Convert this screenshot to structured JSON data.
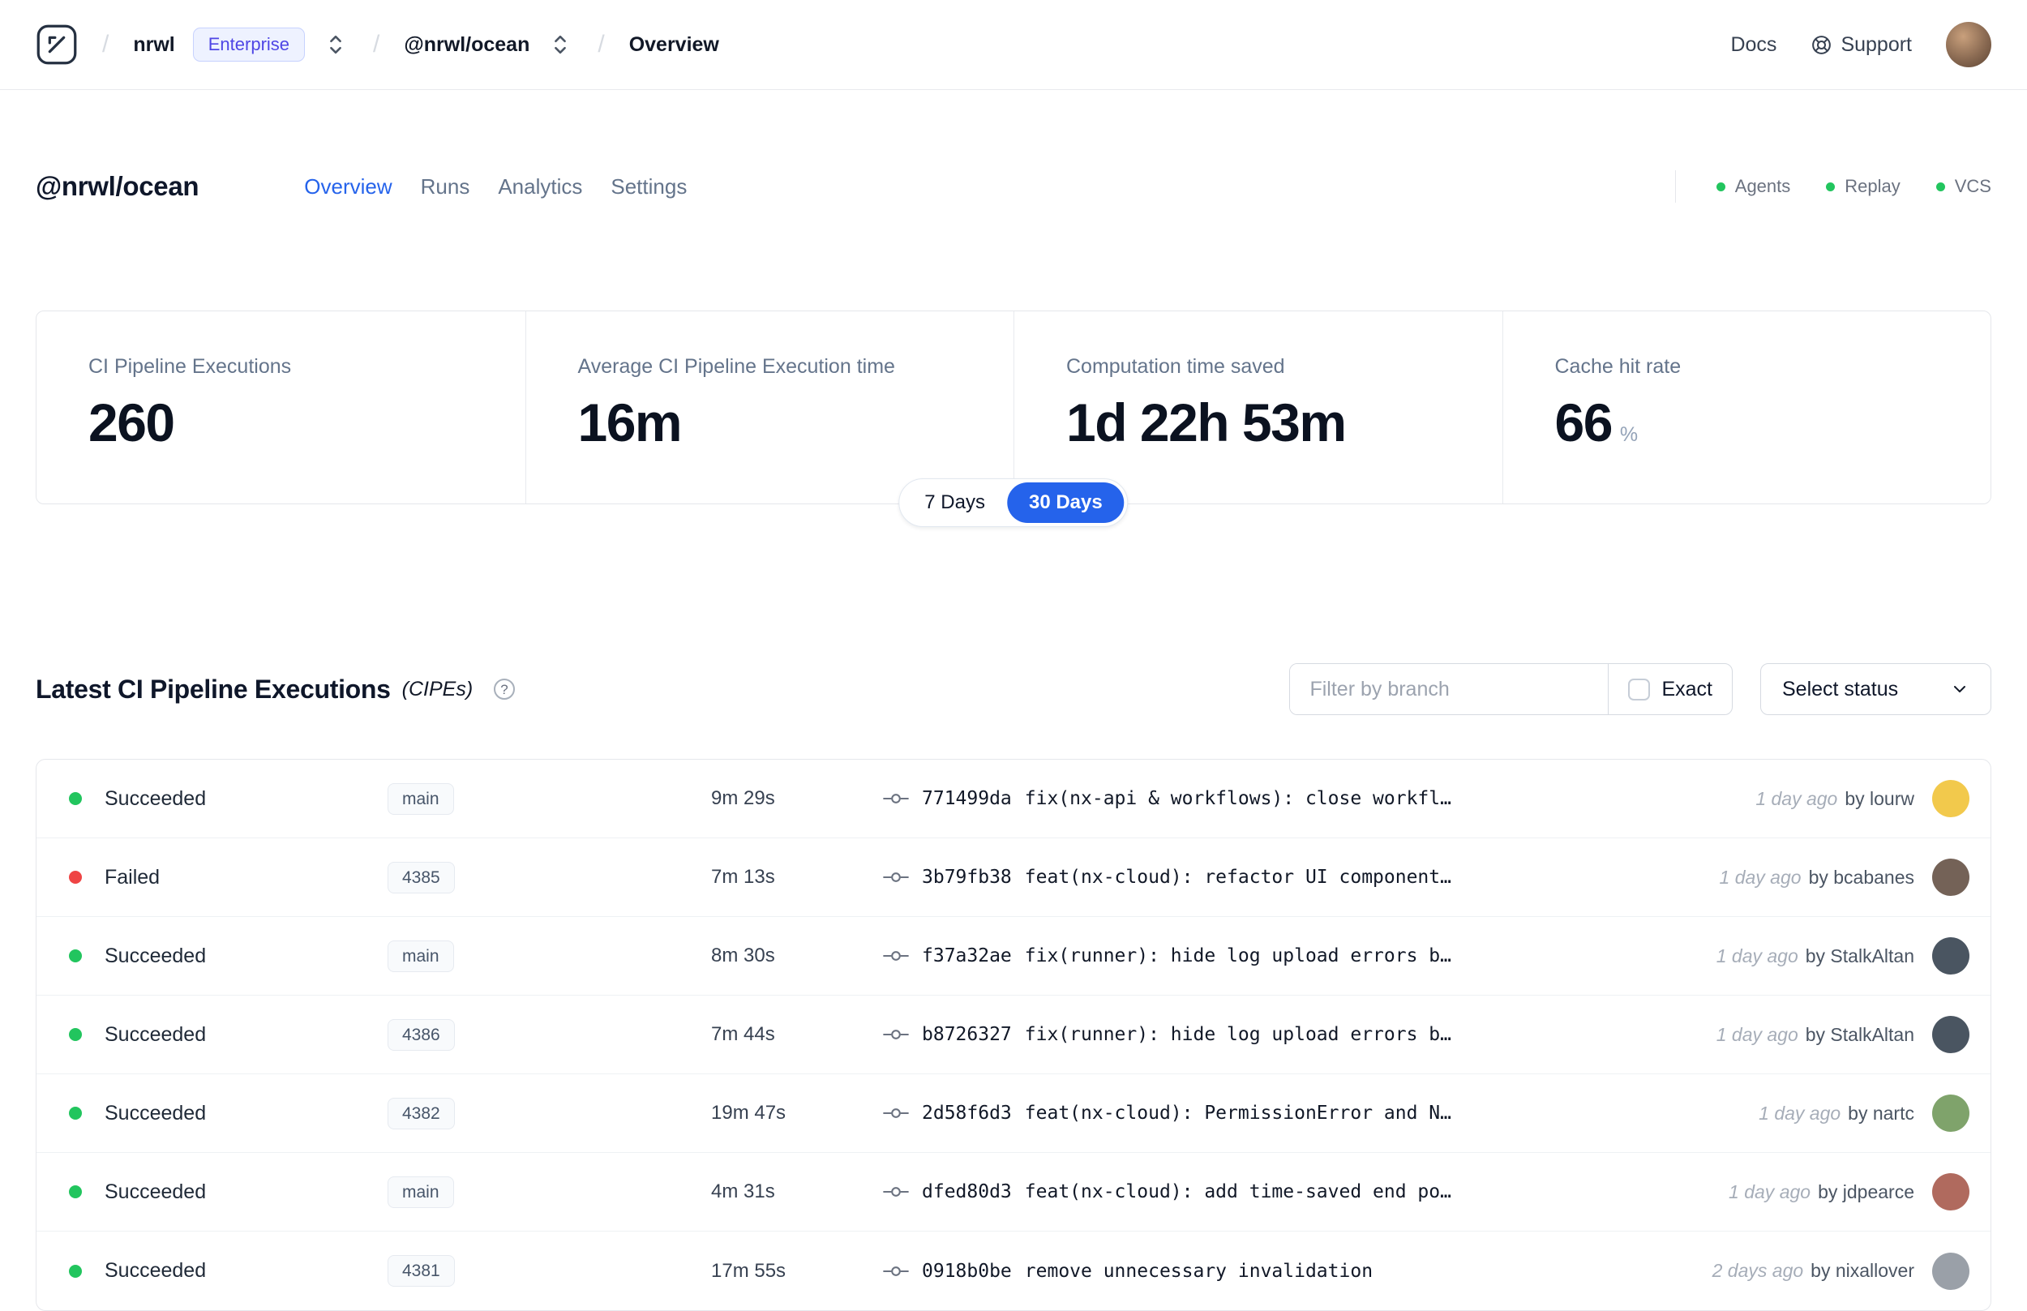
{
  "nav": {
    "breadcrumb": {
      "separator": "/",
      "org": "nrwl",
      "plan_badge": "Enterprise",
      "workspace": "@nrwl/ocean",
      "page": "Overview"
    },
    "docs_label": "Docs",
    "support_label": "Support"
  },
  "workspace": {
    "title": "@nrwl/ocean",
    "tabs": [
      {
        "label": "Overview",
        "active": true
      },
      {
        "label": "Runs",
        "active": false
      },
      {
        "label": "Analytics",
        "active": false
      },
      {
        "label": "Settings",
        "active": false
      }
    ],
    "indicators": [
      {
        "label": "Agents"
      },
      {
        "label": "Replay"
      },
      {
        "label": "VCS"
      }
    ]
  },
  "stats": [
    {
      "label": "CI Pipeline Executions",
      "value": "260"
    },
    {
      "label": "Average CI Pipeline Execution time",
      "value": "16m"
    },
    {
      "label": "Computation time saved",
      "value": "1d 22h 53m"
    },
    {
      "label": "Cache hit rate",
      "value": "66",
      "suffix": "%"
    }
  ],
  "range_toggle": {
    "options": [
      {
        "label": "7 Days",
        "active": false
      },
      {
        "label": "30 Days",
        "active": true
      }
    ]
  },
  "cipes": {
    "title": "Latest CI Pipeline Executions",
    "subtitle": "(CIPEs)",
    "filter": {
      "placeholder": "Filter by branch",
      "exact_label": "Exact"
    },
    "status_select_label": "Select status",
    "rows": [
      {
        "status": "Succeeded",
        "status_color": "green",
        "branch": "main",
        "duration": "9m 29s",
        "hash": "771499da",
        "message": "fix(nx-api & workflows): close workfl…",
        "time": "1 day ago",
        "author": "by lourw",
        "avatar_color": "#f2c94c"
      },
      {
        "status": "Failed",
        "status_color": "red",
        "branch": "4385",
        "duration": "7m 13s",
        "hash": "3b79fb38",
        "message": "feat(nx-cloud): refactor UI component…",
        "time": "1 day ago",
        "author": "by bcabanes",
        "avatar_color": "#746257"
      },
      {
        "status": "Succeeded",
        "status_color": "green",
        "branch": "main",
        "duration": "8m 30s",
        "hash": "f37a32ae",
        "message": "fix(runner): hide log upload errors b…",
        "time": "1 day ago",
        "author": "by StalkAltan",
        "avatar_color": "#4a5561"
      },
      {
        "status": "Succeeded",
        "status_color": "green",
        "branch": "4386",
        "duration": "7m 44s",
        "hash": "b8726327",
        "message": "fix(runner): hide log upload errors b…",
        "time": "1 day ago",
        "author": "by StalkAltan",
        "avatar_color": "#4a5561"
      },
      {
        "status": "Succeeded",
        "status_color": "green",
        "branch": "4382",
        "duration": "19m 47s",
        "hash": "2d58f6d3",
        "message": "feat(nx-cloud): PermissionError and N…",
        "time": "1 day ago",
        "author": "by nartc",
        "avatar_color": "#7fa36b"
      },
      {
        "status": "Succeeded",
        "status_color": "green",
        "branch": "main",
        "duration": "4m 31s",
        "hash": "dfed80d3",
        "message": "feat(nx-cloud): add time-saved end po…",
        "time": "1 day ago",
        "author": "by jdpearce",
        "avatar_color": "#b06a5e"
      },
      {
        "status": "Succeeded",
        "status_color": "green",
        "branch": "4381",
        "duration": "17m 55s",
        "hash": "0918b0be",
        "message": "remove unnecessary invalidation",
        "time": "2 days ago",
        "author": "by nixallover",
        "avatar_color": "#9aa0a8"
      }
    ]
  },
  "colors": {
    "accent": "#2563eb",
    "success": "#22c55e",
    "failure": "#ef4444"
  }
}
